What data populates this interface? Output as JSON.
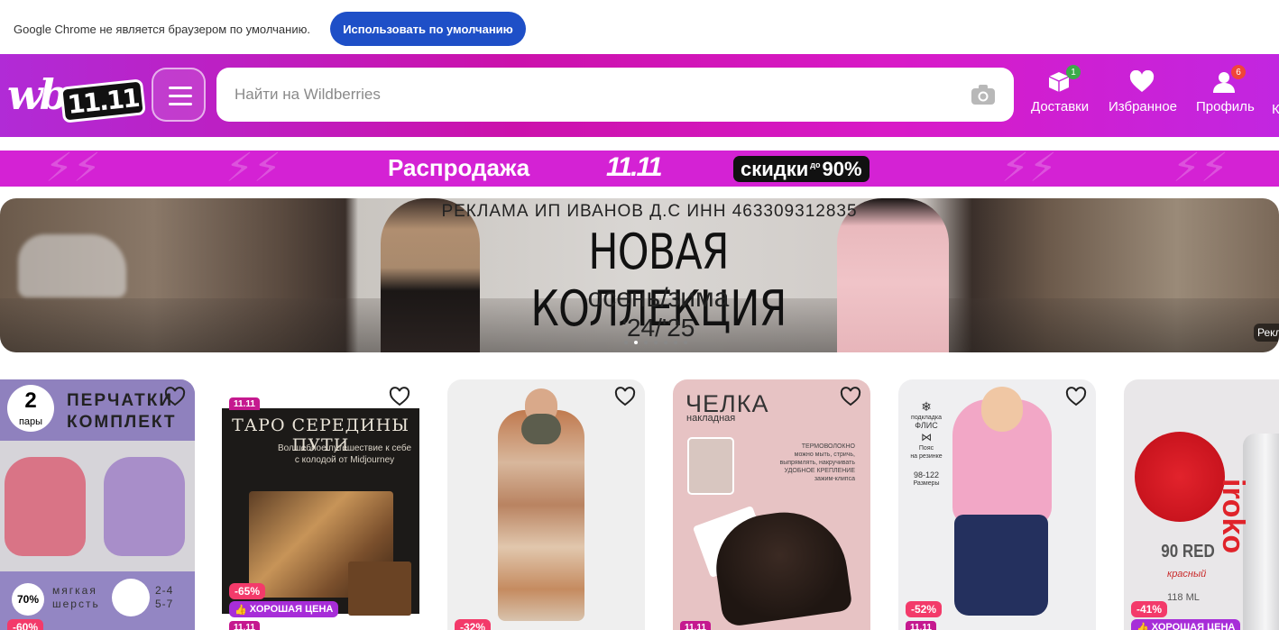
{
  "chrome_bar": {
    "message": "Google Chrome не является браузером по умолчанию.",
    "button": "Использовать по умолчанию"
  },
  "header": {
    "logo_text": "wb",
    "logo_tag": "11.11",
    "search_placeholder": "Найти на Wildberries",
    "nav": [
      {
        "label": "Доставки",
        "badge": "1",
        "badge_color": "#3dab4a"
      },
      {
        "label": "Избранное",
        "badge": ""
      },
      {
        "label": "Профиль",
        "badge": "6",
        "badge_color": "#f0453a"
      },
      {
        "label": "К"
      }
    ],
    "brand_color": "#cb11ab"
  },
  "promo": {
    "title": "Распродажа",
    "event": "11.11",
    "discount": "скидки",
    "discount_prefix": "до",
    "discount_value": "90%"
  },
  "banner": {
    "ad_line": "РЕКЛАМА ИП ИВАНОВ Д.С ИНН 463309312835",
    "title": "НОВАЯ КОЛЛЕКЦИЯ",
    "subtitle": "осень/зима",
    "year": "'24/'25",
    "ad_tag": "Рекл",
    "slide_count": 7,
    "active_slide": 2
  },
  "cards": [
    {
      "title_lines": [
        "ПЕРЧАТКИ",
        "КОМПЛЕКТ"
      ],
      "pairs_num": "2",
      "pairs_label": "пары",
      "wool_pct": "70%",
      "wool_lines": [
        "мягкая",
        "шерсть"
      ],
      "sizes": [
        "2-4",
        "5-7"
      ],
      "discount": "-60%"
    },
    {
      "title": "ТАРО СЕРЕДИНЫ ПУТИ",
      "subtitle": "Волшебное путешествие к себе с колодой от Midjourney",
      "sale_tag": "11.11",
      "discount": "-65%",
      "good_price": "ХОРОШАЯ ЦЕНА",
      "footer_tag": "11.11"
    },
    {
      "discount": "-32%"
    },
    {
      "title": "ЧЕЛКА",
      "subtitle": "накладная",
      "features": [
        "ТЕРМОВОЛОКНО",
        "можно мыть, стричь,",
        "выпрямлять, накручивать",
        "УДОБНОЕ КРЕПЛЕНИЕ",
        "зажим-клипса"
      ],
      "footer_tag": "11.11"
    },
    {
      "features": [
        "подкладка",
        "ФЛИС",
        "Пояс",
        "на резинке",
        "98-122",
        "Размеры"
      ],
      "discount": "-52%",
      "footer_tag": "11.11"
    },
    {
      "shade": "90 RED",
      "shade_name": "красный",
      "volume": "118 ML",
      "brand": "iroko",
      "discount": "-41%",
      "good_price": "ХОРОШАЯ ЦЕНА"
    }
  ]
}
